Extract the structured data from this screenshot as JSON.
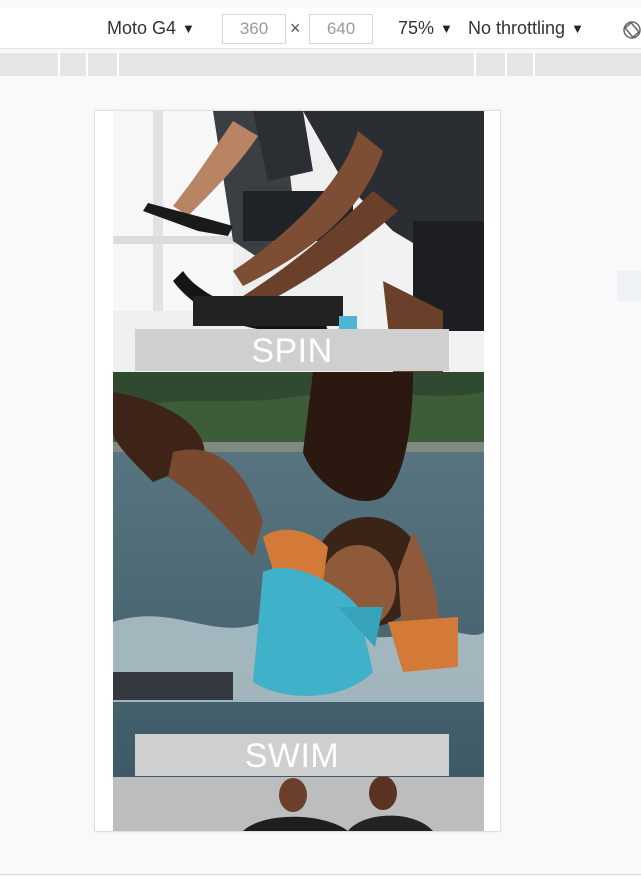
{
  "toolbar": {
    "device": "Moto G4",
    "width": "360",
    "height": "640",
    "times": "×",
    "zoom": "75%",
    "throttle": "No throttling",
    "arrow": "▼"
  },
  "page": {
    "sections": [
      {
        "label": "SPIN"
      },
      {
        "label": "SWIM"
      }
    ]
  },
  "icons": {
    "rotate": "rotate-icon"
  }
}
